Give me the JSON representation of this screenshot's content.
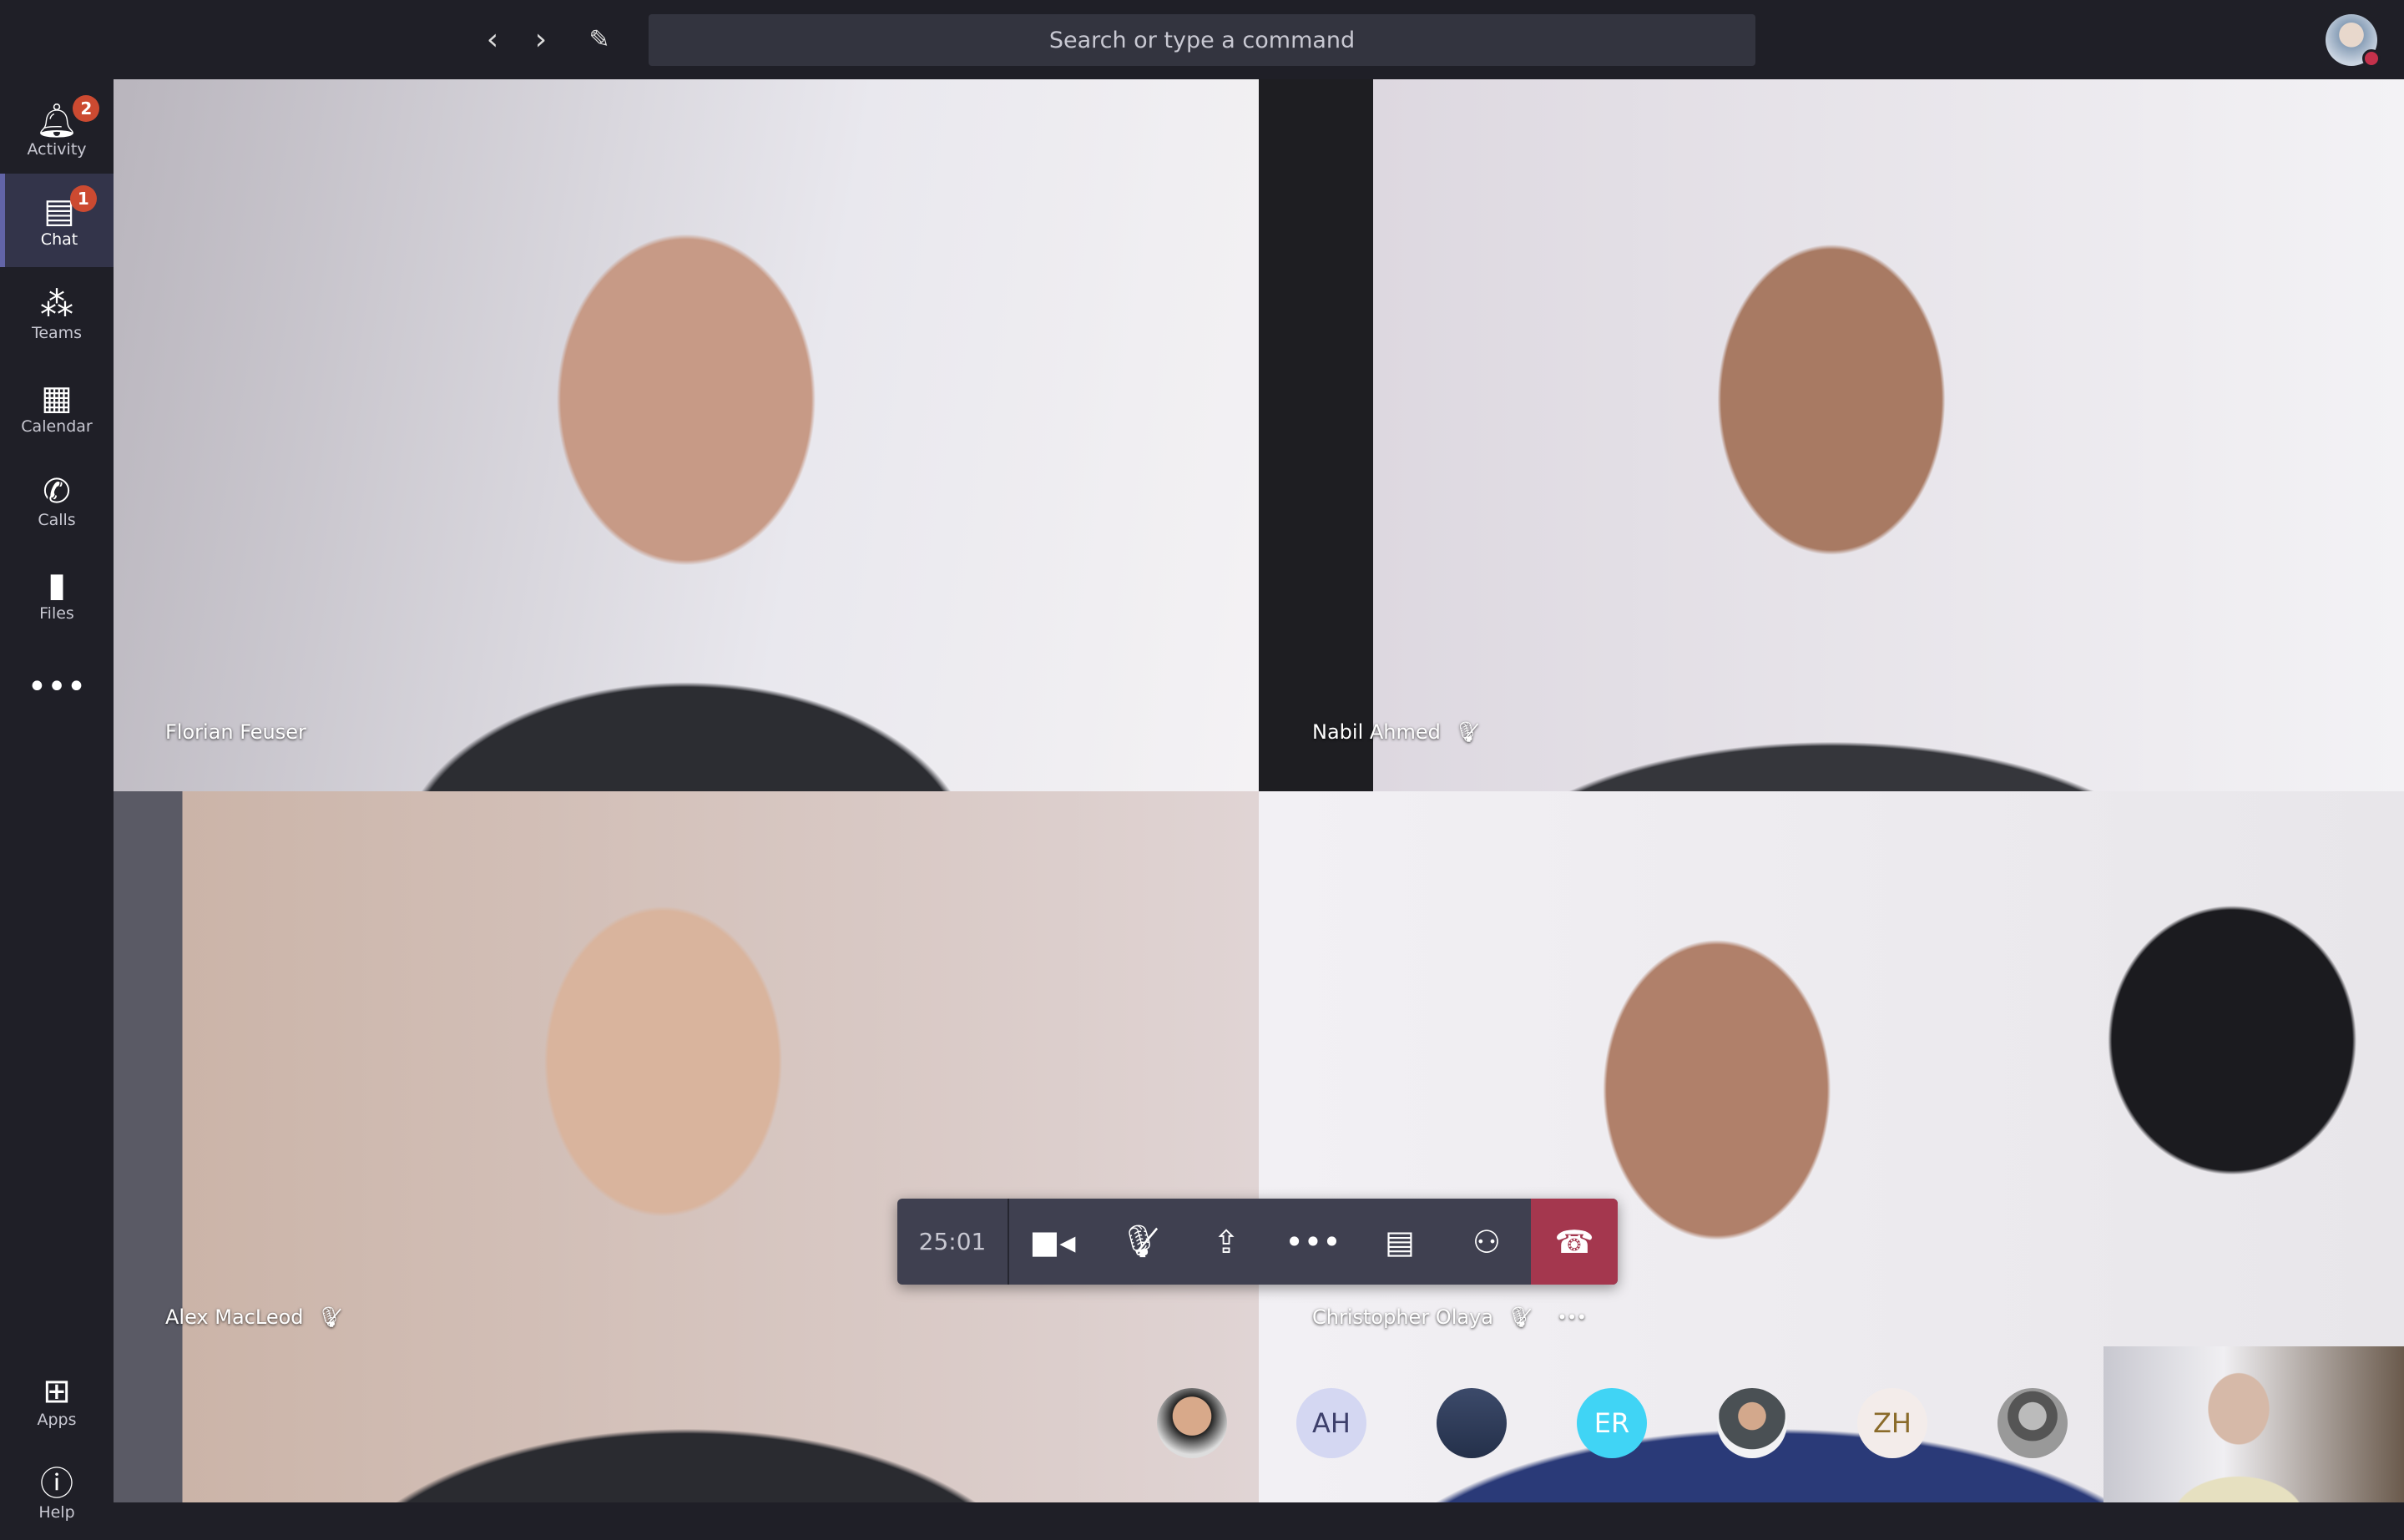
{
  "topbar": {
    "back_icon": "chevron-left",
    "forward_icon": "chevron-right",
    "compose_icon": "compose",
    "search_placeholder": "Search or type a command"
  },
  "sidebar": {
    "items": [
      {
        "label": "Activity",
        "icon": "bell",
        "badge": "2"
      },
      {
        "label": "Chat",
        "icon": "chat",
        "badge": "1",
        "active": true
      },
      {
        "label": "Teams",
        "icon": "teams"
      },
      {
        "label": "Calendar",
        "icon": "calendar"
      },
      {
        "label": "Calls",
        "icon": "phone"
      },
      {
        "label": "Files",
        "icon": "file"
      },
      {
        "label": "Apps",
        "icon": "apps"
      },
      {
        "label": "Help",
        "icon": "help"
      }
    ],
    "more_label": "•••"
  },
  "participants": [
    {
      "name": "Florian Feuser",
      "muted": false
    },
    {
      "name": "Nabil Ahmed",
      "muted": true
    },
    {
      "name": "Alex MacLeod",
      "muted": true
    },
    {
      "name": "Christopher Olaya",
      "muted": true
    }
  ],
  "controls": {
    "timer": "25:01",
    "buttons": [
      "video",
      "mic-muted",
      "share",
      "more",
      "chat",
      "participants",
      "hang-up"
    ],
    "hangup_color": "#a4374e"
  },
  "roster": [
    {
      "initials": "AH",
      "bg": "#d4d7f2",
      "fg": "#3d3f6b"
    },
    {
      "initials": "",
      "photo": true
    },
    {
      "initials": "ER",
      "bg": "#40d4f5",
      "fg": "#ffffff"
    },
    {
      "initials": "",
      "photo": true
    },
    {
      "initials": "ZH",
      "bg": "#f3ecea",
      "fg": "#8a6b2a"
    },
    {
      "initials": "",
      "photo": true
    }
  ],
  "more_label": "•••"
}
